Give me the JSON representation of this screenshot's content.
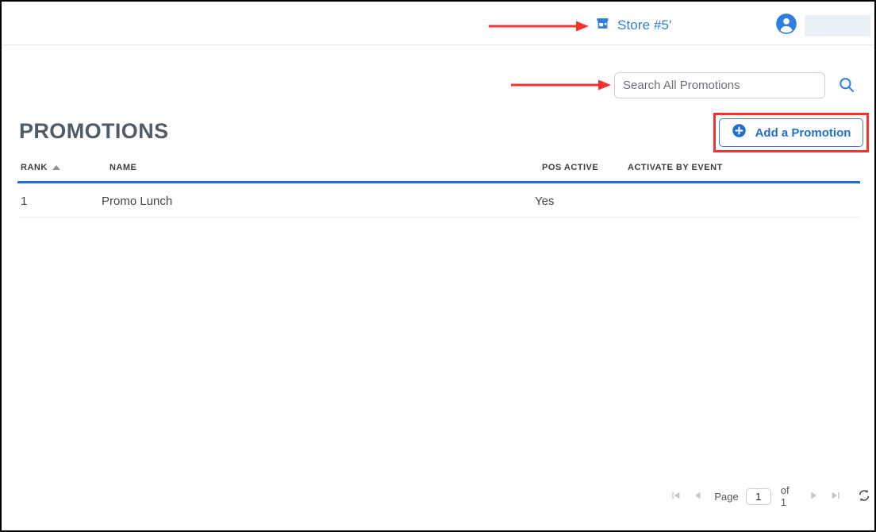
{
  "header": {
    "store_icon": "store-icon",
    "store_label": "Store #5'",
    "avatar_icon": "avatar-person-icon",
    "account_redacted": ""
  },
  "search": {
    "placeholder": "Search All Promotions",
    "value": "",
    "icon": "search-icon"
  },
  "main": {
    "page_title": "PROMOTIONS",
    "add_button": {
      "label": "Add a Promotion",
      "icon": "plus-circle-icon"
    }
  },
  "table": {
    "columns": [
      {
        "key": "rank",
        "label": "RANK",
        "sort": "ascending"
      },
      {
        "key": "name",
        "label": "NAME",
        "sort": "none"
      },
      {
        "key": "pos_active",
        "label": "POS ACTIVE",
        "sort": "none"
      },
      {
        "key": "activate_by_event",
        "label": "ACTIVATE BY EVENT",
        "sort": "none"
      }
    ],
    "rows": [
      {
        "rank": "1",
        "name": "Promo Lunch",
        "pos_active": "Yes",
        "activate_by_event": ""
      }
    ]
  },
  "pagination": {
    "first_icon": "first-page-icon",
    "prev_icon": "previous-page-icon",
    "page_label": "Page",
    "page_value": "1",
    "of_label": "of 1",
    "next_icon": "next-page-icon",
    "last_icon": "last-page-icon",
    "refresh_icon": "refresh-icon"
  },
  "colors": {
    "accent_blue": "#1f6fd0",
    "link_blue": "#2f7de1",
    "annotation_red": "#f5332e",
    "title_gray": "#4f5b66",
    "redacted": "#eaf0f8"
  }
}
